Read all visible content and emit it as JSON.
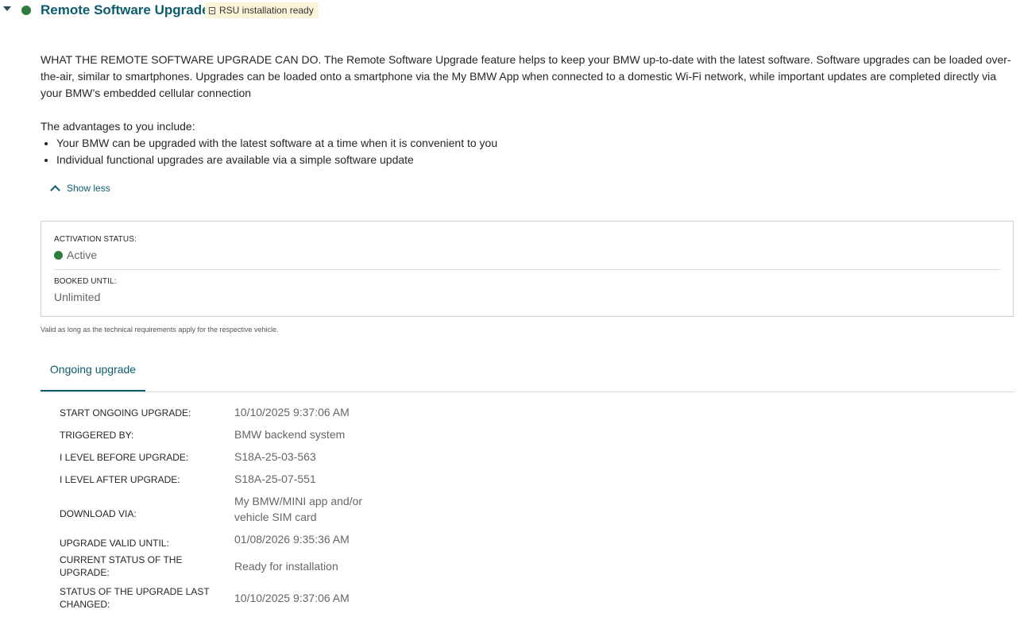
{
  "header": {
    "title": "Remote Software Upgrade",
    "badge_label": "RSU installation ready",
    "status_color": "#2e7d3e",
    "accent_color": "#0d5c6e"
  },
  "description": {
    "paragraph": "WHAT THE REMOTE SOFTWARE UPGRADE CAN DO. The Remote Software Upgrade feature helps to keep your BMW up-to-date with the latest software. Software upgrades can be loaded over-the-air, similar to smartphones. Upgrades can be loaded onto a smartphone via the My BMW App when connected to a domestic Wi-Fi network, while important updates are completed directly via your BMW’s embedded cellular connection",
    "advantages_title": "The advantages to you include:",
    "advantages": [
      "Your BMW can be upgraded with the latest software at a time when it is convenient to you",
      "Individual functional upgrades are available via a simple software update"
    ],
    "show_less_label": "Show less"
  },
  "status_card": {
    "activation_label": "ACTIVATION STATUS:",
    "activation_value": "Active",
    "booked_label": "BOOKED UNTIL:",
    "booked_value": "Unlimited",
    "note": "Valid as long as the technical requirements apply for the respective vehicle."
  },
  "tabs": [
    {
      "label": "Ongoing upgrade",
      "active": true
    }
  ],
  "details": [
    {
      "label": "START ONGOING UPGRADE:",
      "value": "10/10/2025 9:37:06 AM"
    },
    {
      "label": "TRIGGERED BY:",
      "value": "BMW backend system"
    },
    {
      "label": "I LEVEL BEFORE UPGRADE:",
      "value": "S18A-25-03-563"
    },
    {
      "label": "I LEVEL AFTER UPGRADE:",
      "value": "S18A-25-07-551"
    },
    {
      "label": "DOWNLOAD VIA:",
      "value": "My BMW/MINI app and/or vehicle SIM card"
    },
    {
      "label": "UPGRADE VALID UNTIL:",
      "value": "01/08/2026 9:35:36 AM"
    },
    {
      "label": "CURRENT STATUS OF THE UPGRADE:",
      "value": "Ready for installation"
    },
    {
      "label": "STATUS OF THE UPGRADE LAST CHANGED:",
      "value": "10/10/2025 9:37:06 AM"
    }
  ]
}
